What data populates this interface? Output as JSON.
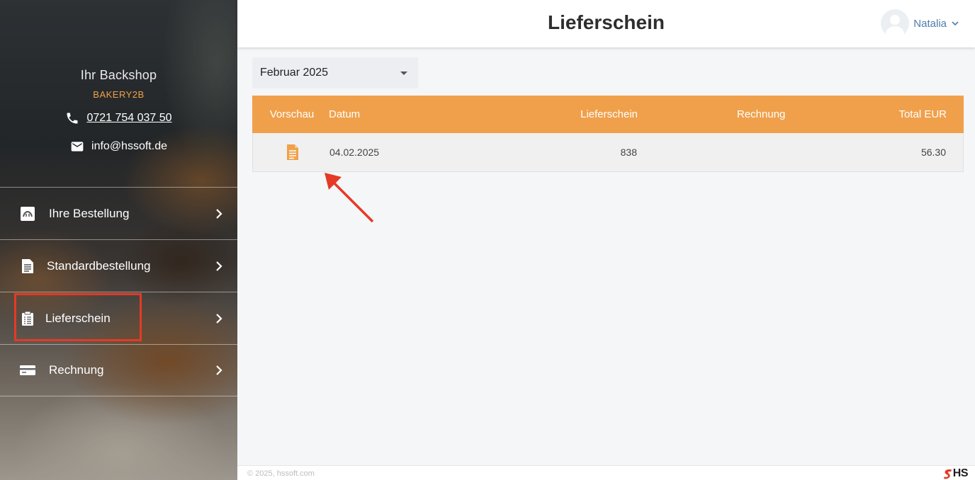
{
  "sidebar": {
    "brand_title": "Ihr Backshop",
    "brand_subtitle": "BAKERY2B",
    "phone": "0721 754 037 50",
    "email": "info@hssoft.de",
    "items": [
      {
        "label": "Ihre Bestellung",
        "icon": "bakery-icon"
      },
      {
        "label": "Standardbestellung",
        "icon": "document-icon"
      },
      {
        "label": "Lieferschein",
        "icon": "clipboard-icon"
      },
      {
        "label": "Rechnung",
        "icon": "card-icon"
      }
    ]
  },
  "header": {
    "title": "Lieferschein",
    "user_name": "Natalia"
  },
  "filter": {
    "month": "Februar 2025"
  },
  "table": {
    "columns": [
      "Vorschau",
      "Datum",
      "Lieferschein",
      "Rechnung",
      "Total EUR"
    ],
    "rows": [
      {
        "datum": "04.02.2025",
        "lieferschein": "838",
        "rechnung": "",
        "total": "56.30"
      }
    ]
  },
  "footer": {
    "copyright": "© 2025, hssoft.com",
    "logo_text": "HS"
  },
  "colors": {
    "accent": "#f0a04b",
    "highlight": "#e53a25",
    "user_link": "#4f7cad"
  }
}
